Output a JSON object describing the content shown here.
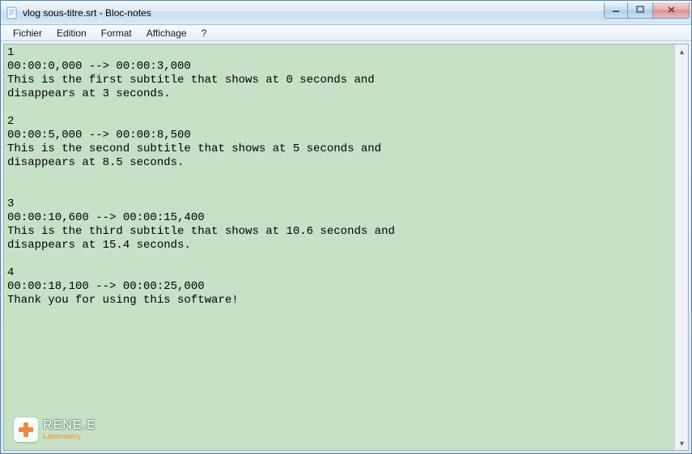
{
  "window": {
    "title": "vlog sous-titre.srt - Bloc-notes"
  },
  "menu": {
    "file": "Fichier",
    "edit": "Edition",
    "format": "Format",
    "view": "Affichage",
    "help": "?"
  },
  "editor": {
    "content": "1\n00:00:0,000 --> 00:00:3,000\nThis is the first subtitle that shows at 0 seconds and\ndisappears at 3 seconds.\n\n2\n00:00:5,000 --> 00:00:8,500\nThis is the second subtitle that shows at 5 seconds and\ndisappears at 8.5 seconds.\n\n\n3\n00:00:10,600 --> 00:00:15,400\nThis is the third subtitle that shows at 10.6 seconds and\ndisappears at 15.4 seconds.\n\n4\n00:00:18,100 --> 00:00:25,000\nThank you for using this software!"
  },
  "watermark": {
    "main": "RENE.E",
    "sub": "Laboratory"
  },
  "subtitle_data": [
    {
      "index": 1,
      "start": "00:00:0,000",
      "end": "00:00:3,000",
      "text": "This is the first subtitle that shows at 0 seconds and\ndisappears at 3 seconds."
    },
    {
      "index": 2,
      "start": "00:00:5,000",
      "end": "00:00:8,500",
      "text": "This is the second subtitle that shows at 5 seconds and\ndisappears at 8.5 seconds."
    },
    {
      "index": 3,
      "start": "00:00:10,600",
      "end": "00:00:15,400",
      "text": "This is the third subtitle that shows at 10.6 seconds and\ndisappears at 15.4 seconds."
    },
    {
      "index": 4,
      "start": "00:00:18,100",
      "end": "00:00:25,000",
      "text": "Thank you for using this software!"
    }
  ]
}
